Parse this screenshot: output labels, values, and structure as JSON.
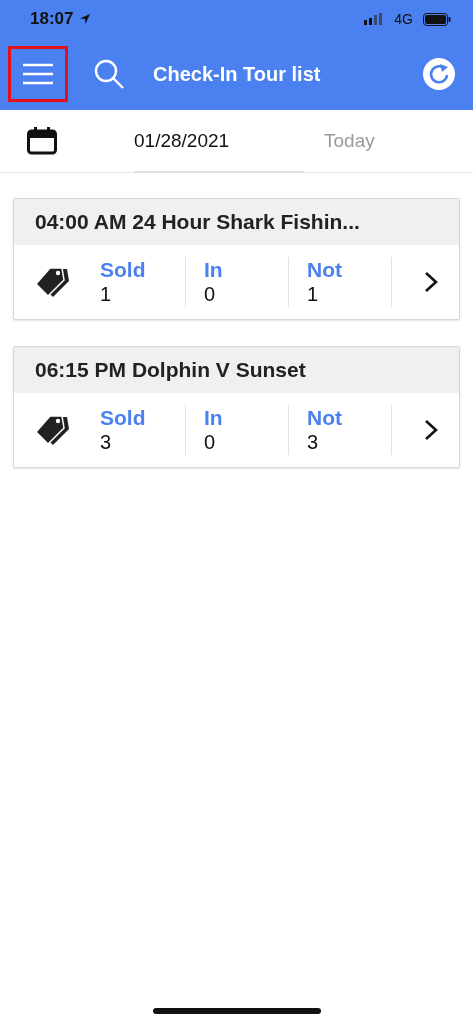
{
  "status_bar": {
    "time": "18:07",
    "network": "4G"
  },
  "nav": {
    "title": "Check-In Tour list",
    "menu_highlighted": true
  },
  "date_bar": {
    "date": "01/28/2021",
    "today": "Today"
  },
  "tours": [
    {
      "title": "04:00 AM 24 Hour Shark Fishin...",
      "stats": [
        {
          "label": "Sold",
          "value": "1"
        },
        {
          "label": "In",
          "value": "0"
        },
        {
          "label": "Not",
          "value": "1"
        }
      ]
    },
    {
      "title": "06:15 PM Dolphin V Sunset",
      "stats": [
        {
          "label": "Sold",
          "value": "3"
        },
        {
          "label": "In",
          "value": "0"
        },
        {
          "label": "Not",
          "value": "3"
        }
      ]
    }
  ]
}
